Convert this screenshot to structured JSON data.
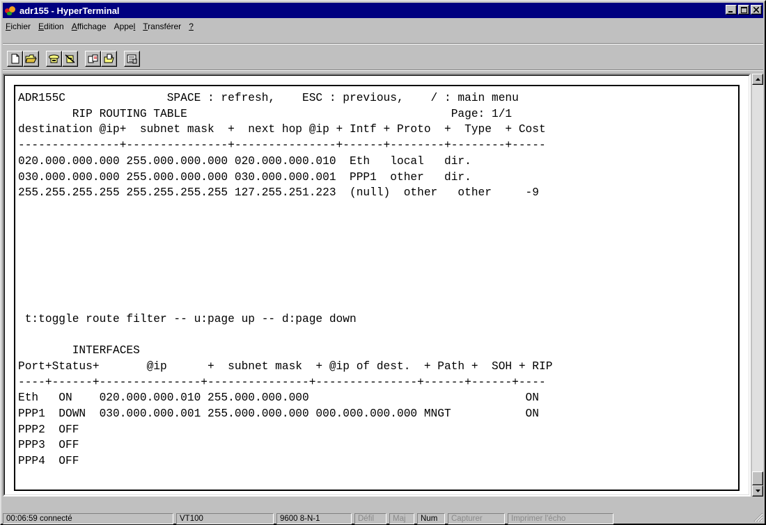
{
  "window": {
    "title": "adr155 - HyperTerminal"
  },
  "menu": [
    "Fichier",
    "Edition",
    "Affichage",
    "Appel",
    "Transférer",
    "?"
  ],
  "toolbar": {
    "icons": [
      "new-file-icon",
      "open-folder-icon",
      "phone-call-icon",
      "phone-hangup-icon",
      "send-icon",
      "receive-icon",
      "properties-icon"
    ]
  },
  "terminal": {
    "lines": [
      "ADR155C               SPACE : refresh,    ESC : previous,    / : main menu",
      "        RIP ROUTING TABLE                                       Page: 1/1",
      "destination @ip+  subnet mask  +  next hop @ip + Intf + Proto  +  Type  + Cost",
      "---------------+---------------+---------------+------+--------+--------+-----",
      "020.000.000.000 255.000.000.000 020.000.000.010  Eth   local   dir.",
      "030.000.000.000 255.000.000.000 030.000.000.001  PPP1  other   dir.",
      "255.255.255.255 255.255.255.255 127.255.251.223  (null)  other   other     -9",
      "",
      "",
      "",
      "",
      "",
      "",
      "",
      " t:toggle route filter -- u:page up -- d:page down",
      "",
      "        INTERFACES",
      "Port+Status+       @ip      +  subnet mask  + @ip of dest.  + Path +  SOH + RIP",
      "----+------+---------------+---------------+---------------+------+------+----",
      "Eth   ON    020.000.000.010 255.000.000.000                                ON",
      "PPP1  DOWN  030.000.000.001 255.000.000.000 000.000.000.000 MNGT           ON",
      "PPP2  OFF",
      "PPP3  OFF",
      "PPP4  OFF"
    ]
  },
  "status": {
    "connected": "00:06:59 connecté",
    "emulation": "VT100",
    "settings": "9600 8-N-1",
    "scroll": "Défil",
    "caps": "Maj",
    "num": "Num",
    "capture": "Capturer",
    "print_echo": "Imprimer l'écho"
  },
  "colors": {
    "titlebar": "#000080",
    "face": "#c0c0c0",
    "terminal_bg": "#ffffff"
  }
}
